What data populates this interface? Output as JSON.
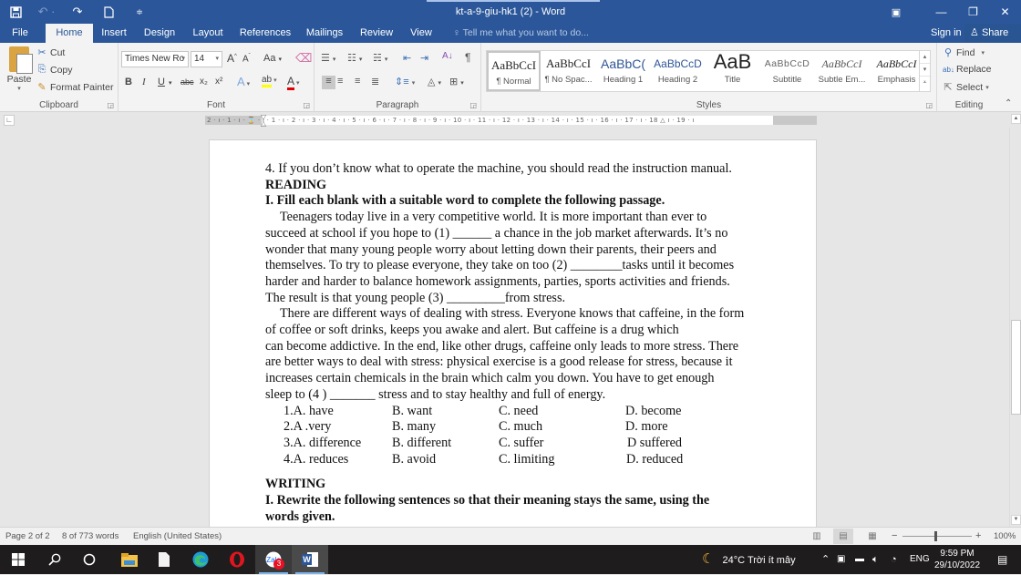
{
  "window": {
    "title": "kt-a-9-giu-hk1 (2) - Word",
    "quick_access": {
      "save_icon": "save-icon",
      "undo_icon": "undo-icon",
      "redo_icon": "redo-icon",
      "new_icon": "new-document-icon",
      "customize_icon": "customize-qat-icon"
    },
    "controls": {
      "ribbon_options": "▣",
      "minimize": "—",
      "restore": "❐",
      "close": "✕"
    }
  },
  "tabs": [
    {
      "label": "File"
    },
    {
      "label": "Home",
      "active": true
    },
    {
      "label": "Insert"
    },
    {
      "label": "Design"
    },
    {
      "label": "Layout"
    },
    {
      "label": "References"
    },
    {
      "label": "Mailings"
    },
    {
      "label": "Review"
    },
    {
      "label": "View"
    }
  ],
  "tell_me": {
    "placeholder": "Tell me what you want to do..."
  },
  "account": {
    "sign_in": "Sign in",
    "share": "Share"
  },
  "ribbon": {
    "clipboard": {
      "label": "Clipboard",
      "paste": "Paste",
      "cut": "Cut",
      "copy": "Copy",
      "format_painter": "Format Painter"
    },
    "font": {
      "label": "Font",
      "font_name": "Times New Ro",
      "font_size": "14",
      "grow": "A",
      "shrink": "A",
      "change_case": "Aa",
      "bold": "B",
      "italic": "I",
      "underline": "U",
      "strikethrough": "abc",
      "subscript": "x₂",
      "superscript": "x²",
      "text_effects": "A",
      "highlight": "ab",
      "font_color": "A",
      "font_color_hex": "#e00000",
      "highlight_hex": "#ffff00"
    },
    "paragraph": {
      "label": "Paragraph",
      "pilcrow": "¶",
      "sort": "A↓"
    },
    "styles": {
      "label": "Styles",
      "items": [
        {
          "preview": "AaBbCcI",
          "name": "¶ Normal",
          "selected": true
        },
        {
          "preview": "AaBbCcI",
          "name": "¶ No Spac..."
        },
        {
          "preview": "AaBbC(",
          "name": "Heading 1"
        },
        {
          "preview": "AaBbCcD",
          "name": "Heading 2"
        },
        {
          "preview": "AaB",
          "name": "Title"
        },
        {
          "preview": "AaBbCcD",
          "name": "Subtitle"
        },
        {
          "preview": "AaBbCcI",
          "name": "Subtle Em..."
        },
        {
          "preview": "AaBbCcI",
          "name": "Emphasis"
        }
      ]
    },
    "editing": {
      "label": "Editing",
      "find": "Find",
      "replace": "Replace",
      "select": "Select"
    }
  },
  "ruler": {
    "ticks": "2 · ı · 1 · ı · ⌛ · ı · 1 · ı · 2 · ı · 3 · ı · 4 · ı · 5 · ı · 6 · ı · 7 · ı · 8 · ı · 9 · ı · 10 · ı · 11 · ı · 12 · ı · 13 · ı · 14 · ı · 15 · ı · 16 · ı · 17 · ı · 18 △ ı · 19 · ı"
  },
  "document": {
    "lines": [
      "4. If you don’t know what to operate the machine, you should read the instruction manual.",
      "READING",
      "I. Fill each blank with a suitable word to complete the following passage.",
      "Teenagers today live in a very competitive world. It is more  important than ever to",
      "succeed at school if you hope to (1) ______ a chance in the job market afterwards. It’s no",
      "wonder that many young people worry  about  letting down their parents, their peers and",
      "themselves. To try to please everyone, they take on too (2) ________tasks until it becomes",
      "harder and harder to balance homework assignments, parties, sports activities and friends.",
      "The result is that young people (3) _________from stress.",
      "There are different ways of dealing with stress. Everyone knows that caffeine, in the form",
      "of coffee or soft drinks, keeps you awake and alert. But caffeine is a drug which",
      "can  become addictive. In the end, like other drugs, caffeine only leads to more stress. There",
      "are better  ways  to deal with stress: physical exercise is a good release for stress, because  it",
      "increases certain chemicals in the brain which calm you down. You have to get enough",
      "sleep to (4 ) _______ stress and to stay healthy and full of energy."
    ],
    "options": [
      {
        "a": "1.A. have",
        "b": "B. want",
        "c": "C. need",
        "d": "D. become"
      },
      {
        "a": "2.A .very",
        "b": "B. many",
        "c": "C. much",
        "d": "D. more"
      },
      {
        "a": "3.A. difference",
        "b": "B. different",
        "c": "C. suffer",
        "d": "D  suffered"
      },
      {
        "a": "4.A. reduces",
        "b": "B. avoid",
        "c": "C. limiting",
        "d": " D. reduced"
      }
    ],
    "writing_heading": "WRITING",
    "writing_instruction_1": "I. Rewrite the following sentences so that their meaning stays the same, using the",
    "writing_instruction_2": "words given."
  },
  "status": {
    "page": "Page 2 of 2",
    "words": "8 of 773 words",
    "language": "English (United States)",
    "zoom_minus": "−",
    "zoom_plus": "+",
    "zoom": "100%",
    "zoom_level": 1.0
  },
  "taskbar": {
    "apps": [
      {
        "name": "start",
        "glyph": "⊞"
      },
      {
        "name": "search",
        "glyph": "⚲"
      },
      {
        "name": "task-view",
        "glyph": "○"
      },
      {
        "name": "file-explorer",
        "glyph": "▭"
      },
      {
        "name": "notepad",
        "glyph": "▯"
      },
      {
        "name": "edge",
        "glyph": "◉"
      },
      {
        "name": "opera",
        "glyph": "O"
      },
      {
        "name": "zalo",
        "glyph": "Z"
      },
      {
        "name": "word",
        "glyph": "W"
      }
    ],
    "zalo_badge": "3",
    "weather": "24°C  Trời ít mây",
    "language": "ENG",
    "time": "9:59 PM",
    "date": "29/10/2022"
  }
}
